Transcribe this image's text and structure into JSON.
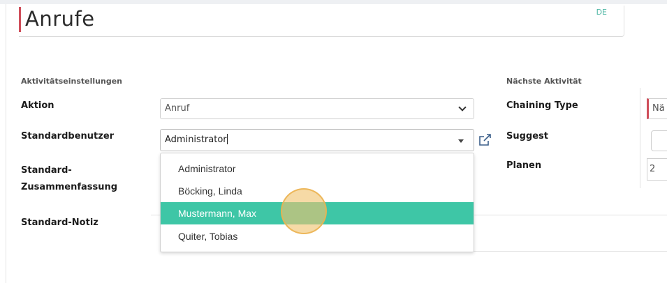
{
  "page": {
    "title": "Anrufe",
    "language_badge": "DE"
  },
  "sections": {
    "activity_settings": "Aktivitätseinstellungen",
    "next_activity": "Nächste Aktivität"
  },
  "fields": {
    "aktion": {
      "label": "Aktion",
      "value": "Anruf"
    },
    "standardbenutzer": {
      "label": "Standardbenutzer",
      "value": "Administrator"
    },
    "standard_zusammenfassung": {
      "label_line1": "Standard-",
      "label_line2": "Zusammenfassung"
    },
    "standard_notiz": {
      "label": "Standard-Notiz"
    }
  },
  "user_dropdown": {
    "options": [
      "Administrator",
      "Böcking, Linda",
      "Mustermann, Max",
      "Quiter, Tobias"
    ],
    "selected": "Mustermann, Max"
  },
  "next_activity_fields": {
    "chaining_type": {
      "label": "Chaining Type",
      "value": "Nä"
    },
    "suggest": {
      "label": "Suggest"
    },
    "planen": {
      "label": "Planen",
      "value": "2"
    }
  },
  "colors": {
    "accent": "#3ec6a6",
    "required_marker": "#cf4e5a",
    "lang_badge": "#4fb7a5"
  }
}
